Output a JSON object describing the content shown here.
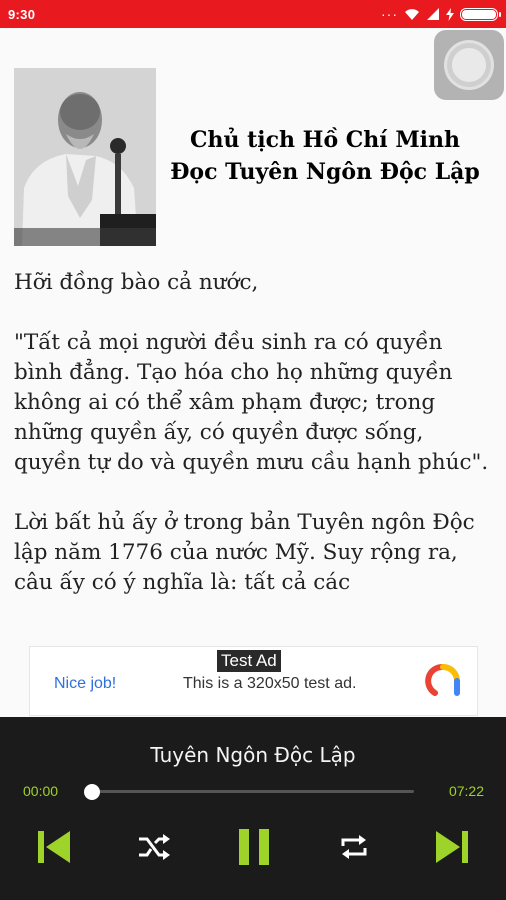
{
  "status_bar": {
    "time": "9:30",
    "dots": "···",
    "colors": {
      "background": "#e8191f"
    }
  },
  "header": {
    "portrait_icon": "portrait-photo",
    "title_line1": "Chủ tịch Hồ Chí Minh",
    "title_line2": "Đọc Tuyên Ngôn Độc Lập"
  },
  "article": {
    "paragraphs": [
      "Hỡi đồng bào cả nước,",
      "\"Tất cả mọi người đều sinh ra có quyền bình đẳng. Tạo hóa cho họ những quyền không ai có thể xâm phạm được; trong những quyền ấy, có quyền được sống, quyền tự do và quyền mưu cầu hạnh phúc\".",
      "Lời bất hủ ấy ở trong bản Tuyên ngôn Độc lập năm 1776 của nước Mỹ. Suy rộng ra, câu ấy có ý nghĩa là: tất cả các"
    ]
  },
  "ad": {
    "tag": "Test Ad",
    "nice_job": "Nice job!",
    "text": "This is a 320x50 test ad.",
    "logo_icon": "admob-logo-icon"
  },
  "player": {
    "track_title": "Tuyên Ngôn Độc Lập",
    "current_time": "00:00",
    "total_time": "07:22",
    "progress": 0.0,
    "accent": "#9ed32a",
    "controls": [
      "skip-previous-icon",
      "shuffle-icon",
      "pause-icon",
      "repeat-icon",
      "skip-next-icon"
    ]
  }
}
